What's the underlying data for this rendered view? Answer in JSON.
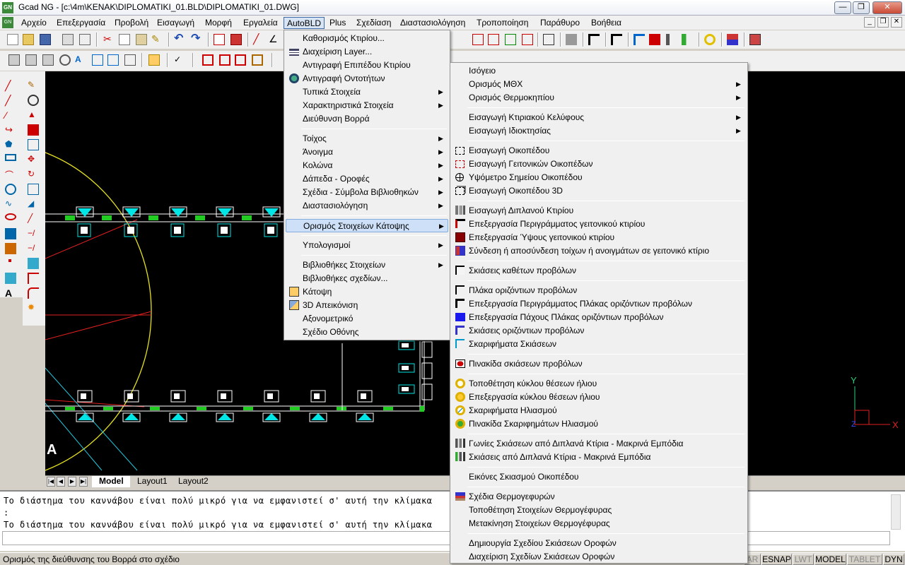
{
  "window": {
    "title": "Gcad NG  - [c:\\4m\\KENAK\\DIPLOMATIKI_01.BLD\\DIPLOMATIKI_01.DWG]",
    "app_icon": "gcad-icon"
  },
  "menubar": [
    "Αρχείο",
    "Επεξεργασία",
    "Προβολή",
    "Εισαγωγή",
    "Μορφή",
    "Εργαλεία",
    "AutoBLD",
    "Plus",
    "Σχεδίαση",
    "Διαστασιολόγηση",
    "Τροποποίηση",
    "Παράθυρο",
    "Βοήθεια"
  ],
  "active_menu": "AutoBLD",
  "autobld_menu": [
    {
      "label": "Καθορισμός Κτιρίου...",
      "submenu": false,
      "icon": ""
    },
    {
      "label": "Διαχείριση Layer...",
      "submenu": false,
      "icon": "layers-icon"
    },
    {
      "label": "Αντιγραφή Επιπέδου Κτιρίου",
      "submenu": false,
      "icon": ""
    },
    {
      "label": "Αντιγραφή Οντοτήτων",
      "submenu": false,
      "icon": "copy-entities-icon"
    },
    {
      "label": "Τυπικά Στοιχεία",
      "submenu": true,
      "icon": ""
    },
    {
      "label": "Χαρακτηριστικά Στοιχεία",
      "submenu": true,
      "icon": ""
    },
    {
      "label": "Διεύθυνση Βορρά",
      "submenu": false,
      "icon": ""
    },
    {
      "label": "Τοίχος",
      "submenu": true,
      "icon": ""
    },
    {
      "label": "Άνοιγμα",
      "submenu": true,
      "icon": ""
    },
    {
      "label": "Κολώνα",
      "submenu": true,
      "icon": ""
    },
    {
      "label": "Δάπεδα - Οροφές",
      "submenu": true,
      "icon": ""
    },
    {
      "label": "Σχέδια - Σύμβολα Βιβλιοθηκών",
      "submenu": true,
      "icon": ""
    },
    {
      "label": "Διαστασιολόγηση",
      "submenu": true,
      "icon": ""
    },
    {
      "label": "Ορισμός Στοιχείων Κάτοψης",
      "submenu": true,
      "icon": ""
    },
    {
      "label": "Υπολογισμοί",
      "submenu": true,
      "icon": ""
    },
    {
      "label": "Βιβλιοθήκες Στοιχείων",
      "submenu": true,
      "icon": ""
    },
    {
      "label": "Βιβλιοθήκες σχεδίων...",
      "submenu": false,
      "icon": ""
    },
    {
      "label": "Κάτοψη",
      "submenu": false,
      "icon": "plan-view-icon"
    },
    {
      "label": "3D Απεικόνιση",
      "submenu": false,
      "icon": "3d-view-icon"
    },
    {
      "label": "Αξονομετρικό",
      "submenu": false,
      "icon": ""
    },
    {
      "label": "Σχέδιο Οθόνης",
      "submenu": false,
      "icon": ""
    }
  ],
  "autobld_highlighted": "Ορισμός Στοιχείων Κάτοψης",
  "submenu": [
    {
      "label": "Ισόγειο",
      "submenu": false,
      "icon": ""
    },
    {
      "label": "Ορισμός ΜΘΧ",
      "submenu": true,
      "icon": ""
    },
    {
      "label": "Ορισμός Θερμοκηπίου",
      "submenu": true,
      "icon": ""
    },
    {
      "label": "Εισαγωγή Κτιριακού Κελύφους",
      "submenu": true,
      "icon": ""
    },
    {
      "label": "Εισαγωγή Ιδιοκτησίας",
      "submenu": true,
      "icon": ""
    },
    {
      "label": "Εισαγωγή Οικοπέδου",
      "submenu": false,
      "icon": "plot-icon"
    },
    {
      "label": "Εισαγωγή Γειτονικών Οικοπέδων",
      "submenu": false,
      "icon": "neighbor-plots-icon"
    },
    {
      "label": "Υψόμετρο Σημείου Οικοπέδου",
      "submenu": false,
      "icon": "elevation-point-icon"
    },
    {
      "label": "Εισαγωγή Οικοπέδου 3D",
      "submenu": false,
      "icon": "plot-3d-icon"
    },
    {
      "label": "Εισαγωγή Διπλανού Κτιρίου",
      "submenu": false,
      "icon": "adjacent-building-icon"
    },
    {
      "label": "Επεξεργασία Περιγράμματος γειτονικού κτιρίου",
      "submenu": false,
      "icon": "edit-outline-icon"
    },
    {
      "label": "Επεξεργασία Ύψους γειτονικού κτιρίου",
      "submenu": false,
      "icon": "edit-height-icon"
    },
    {
      "label": "Σύνδεση ή αποσύνδεση τοίχων ή ανοιγμάτων σε γειτονικό κτίριο",
      "submenu": false,
      "icon": "connect-walls-icon"
    },
    {
      "label": "Σκιάσεις καθέτων προβόλων",
      "submenu": false,
      "icon": "vertical-shading-icon"
    },
    {
      "label": "Πλάκα οριζόντιων προβόλων",
      "submenu": false,
      "icon": "horizontal-slab-icon"
    },
    {
      "label": "Επεξεργασία Περιγράμματος Πλάκας οριζόντιων προβόλων",
      "submenu": false,
      "icon": "edit-slab-outline-icon"
    },
    {
      "label": "Επεξεργασία Πάχους Πλάκας οριζόντιων προβόλων",
      "submenu": false,
      "icon": "edit-slab-thickness-icon"
    },
    {
      "label": "Σκιάσεις οριζόντιων προβόλων",
      "submenu": false,
      "icon": "horizontal-shading-icon"
    },
    {
      "label": "Σκαριφήματα Σκιάσεων",
      "submenu": false,
      "icon": "shading-sketch-icon"
    },
    {
      "label": "Πινακίδα σκιάσεων προβόλων",
      "submenu": false,
      "icon": "shading-table-icon"
    },
    {
      "label": "Τοποθέτηση κύκλου θέσεων ήλιου",
      "submenu": false,
      "icon": "sun-circle-icon"
    },
    {
      "label": "Επεξεργασία κύκλου θέσεων ήλιου",
      "submenu": false,
      "icon": "edit-sun-circle-icon"
    },
    {
      "label": "Σκαριφήματα Ηλιασμού",
      "submenu": false,
      "icon": "insolation-sketch-icon"
    },
    {
      "label": "Πινακίδα Σκαριφημάτων Ηλιασμού",
      "submenu": false,
      "icon": "insolation-table-icon"
    },
    {
      "label": "Γωνίες Σκιάσεων από Διπλανά Κτίρια - Μακρινά Εμπόδια",
      "submenu": false,
      "icon": "shading-angles-icon"
    },
    {
      "label": "Σκιάσεις από Διπλανά Κτίρια - Μακρινά Εμπόδια",
      "submenu": false,
      "icon": "adjacent-shading-icon"
    },
    {
      "label": "Εικόνες Σκιασμού Οικοπέδου",
      "submenu": false,
      "icon": ""
    },
    {
      "label": "Σχέδια Θερμογεφυρών",
      "submenu": false,
      "icon": "thermal-bridge-icon"
    },
    {
      "label": "Τοποθέτηση Στοιχείων Θερμογέφυρας",
      "submenu": false,
      "icon": ""
    },
    {
      "label": "Μετακίνηση Στοιχείων Θερμογέφυρας",
      "submenu": false,
      "icon": ""
    },
    {
      "label": "Δημιουργία Σχεδίου Σκιάσεων Οροφών",
      "submenu": false,
      "icon": ""
    },
    {
      "label": "Διαχείριση Σχεδίων Σκιάσεων Οροφών",
      "submenu": false,
      "icon": ""
    }
  ],
  "layout_tabs": [
    "Model",
    "Layout1",
    "Layout2"
  ],
  "active_tab": "Model",
  "command_lines": [
    "Το διάστημα του καννάβου είναι πολύ μικρό για να εμφανιστεί σ' αυτή την κλίμακα",
    ":",
    "Το διάστημα του καννάβου είναι πολύ μικρό για να εμφανιστεί σ' αυτή την κλίμακα"
  ],
  "status_message": "Ορισμός της διεύθυνσης του Βορρά στο σχέδιο",
  "status_buttons": [
    {
      "label": "AR",
      "on": false
    },
    {
      "label": "ESNAP",
      "on": true
    },
    {
      "label": "LWT",
      "on": false
    },
    {
      "label": "MODEL",
      "on": true
    },
    {
      "label": "TABLET",
      "on": false
    },
    {
      "label": "DYN",
      "on": true
    }
  ],
  "drawing_text": "A",
  "ucs": {
    "x_label": "X",
    "y_label": "Y",
    "z_label": "Z"
  },
  "colors": {
    "canvas": "#000000",
    "menu_highlight": "#cde0f7",
    "wall": "#ffffff",
    "window_fill": "#00e5e5",
    "green_element": "#22cc22",
    "sun_circle": "#e6e020",
    "red_line": "#e02020",
    "cyan_line": "#20c8e0"
  }
}
